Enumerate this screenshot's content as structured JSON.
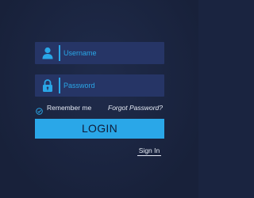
{
  "form": {
    "username": {
      "icon": "user-icon",
      "placeholder": "Username",
      "value": ""
    },
    "password": {
      "icon": "lock-icon",
      "placeholder": "Password",
      "value": ""
    },
    "remember": {
      "icon": "check-circle-icon",
      "label": "Remember me",
      "checked": true
    },
    "forgot_label": "Forgot Password?",
    "login_label": "LOGIN",
    "signin_label": "Sign In"
  },
  "colors": {
    "background": "#1a2440",
    "field_background": "#263566",
    "accent": "#2aa7e8",
    "text": "#e6ebf5",
    "button_text": "#0f1c38"
  }
}
